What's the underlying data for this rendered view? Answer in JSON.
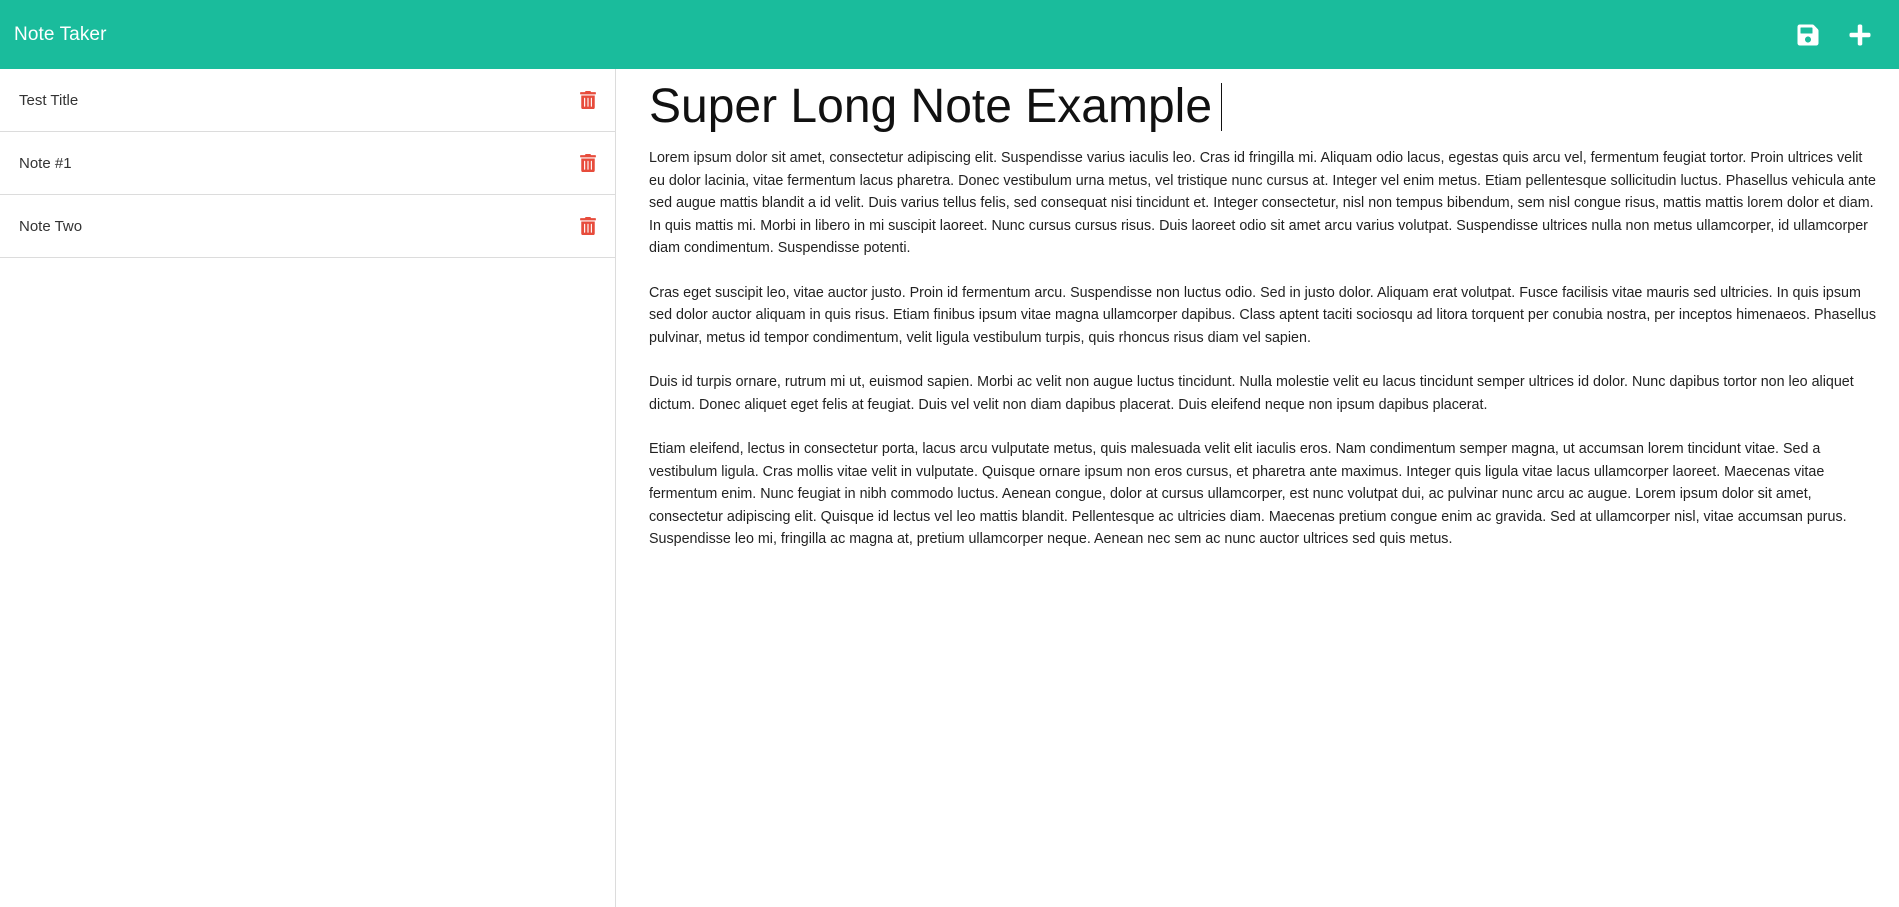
{
  "navbar": {
    "brand": "Note Taker",
    "icons": {
      "save": "save-icon",
      "add": "plus-icon"
    }
  },
  "sidebar": {
    "notes": [
      {
        "title": "Test Title",
        "delete_icon": "trash-icon"
      },
      {
        "title": "Note #1",
        "delete_icon": "trash-icon"
      },
      {
        "title": "Note Two",
        "delete_icon": "trash-icon"
      }
    ]
  },
  "editor": {
    "title": "Super Long Note Example",
    "paragraphs": [
      "Lorem ipsum dolor sit amet, consectetur adipiscing elit. Suspendisse varius iaculis leo. Cras id fringilla mi. Aliquam odio lacus, egestas quis arcu vel, fermentum feugiat tortor. Proin ultrices velit eu dolor lacinia, vitae fermentum lacus pharetra. Donec vestibulum urna metus, vel tristique nunc cursus at. Integer vel enim metus. Etiam pellentesque sollicitudin luctus. Phasellus vehicula ante sed augue mattis blandit a id velit. Duis varius tellus felis, sed consequat nisi tincidunt et. Integer consectetur, nisl non tempus bibendum, sem nisl congue risus, mattis mattis lorem dolor et diam. In quis mattis mi. Morbi in libero in mi suscipit laoreet. Nunc cursus cursus risus. Duis laoreet odio sit amet arcu varius volutpat. Suspendisse ultrices nulla non metus ullamcorper, id ullamcorper diam condimentum. Suspendisse potenti.",
      "Cras eget suscipit leo, vitae auctor justo. Proin id fermentum arcu. Suspendisse non luctus odio. Sed in justo dolor. Aliquam erat volutpat. Fusce facilisis vitae mauris sed ultricies. In quis ipsum sed dolor auctor aliquam in quis risus. Etiam finibus ipsum vitae magna ullamcorper dapibus. Class aptent taciti sociosqu ad litora torquent per conubia nostra, per inceptos himenaeos. Phasellus pulvinar, metus id tempor condimentum, velit ligula vestibulum turpis, quis rhoncus risus diam vel sapien.",
      "Duis id turpis ornare, rutrum mi ut, euismod sapien. Morbi ac velit non augue luctus tincidunt. Nulla molestie velit eu lacus tincidunt semper ultrices id dolor. Nunc dapibus tortor non leo aliquet dictum. Donec aliquet eget felis at feugiat. Duis vel velit non diam dapibus placerat. Duis eleifend neque non ipsum dapibus placerat.",
      "Etiam eleifend, lectus in consectetur porta, lacus arcu vulputate metus, quis malesuada velit elit iaculis eros. Nam condimentum semper magna, ut accumsan lorem tincidunt vitae. Sed a vestibulum ligula. Cras mollis vitae velit in vulputate. Quisque ornare ipsum non eros cursus, et pharetra ante maximus. Integer quis ligula vitae lacus ullamcorper laoreet. Maecenas vitae fermentum enim. Nunc feugiat in nibh commodo luctus. Aenean congue, dolor at cursus ullamcorper, est nunc volutpat dui, ac pulvinar nunc arcu ac augue. Lorem ipsum dolor sit amet, consectetur adipiscing elit. Quisque id lectus vel leo mattis blandit. Pellentesque ac ultricies diam. Maecenas pretium congue enim ac gravida. Sed at ullamcorper nisl, vitae accumsan purus. Suspendisse leo mi, fringilla ac magna at, pretium ullamcorper neque. Aenean nec sem ac nunc auctor ultrices sed quis metus."
    ]
  },
  "colors": {
    "navbar": "#1abc9c",
    "delete": "#e74c3c",
    "divider": "#dcdcdc"
  }
}
